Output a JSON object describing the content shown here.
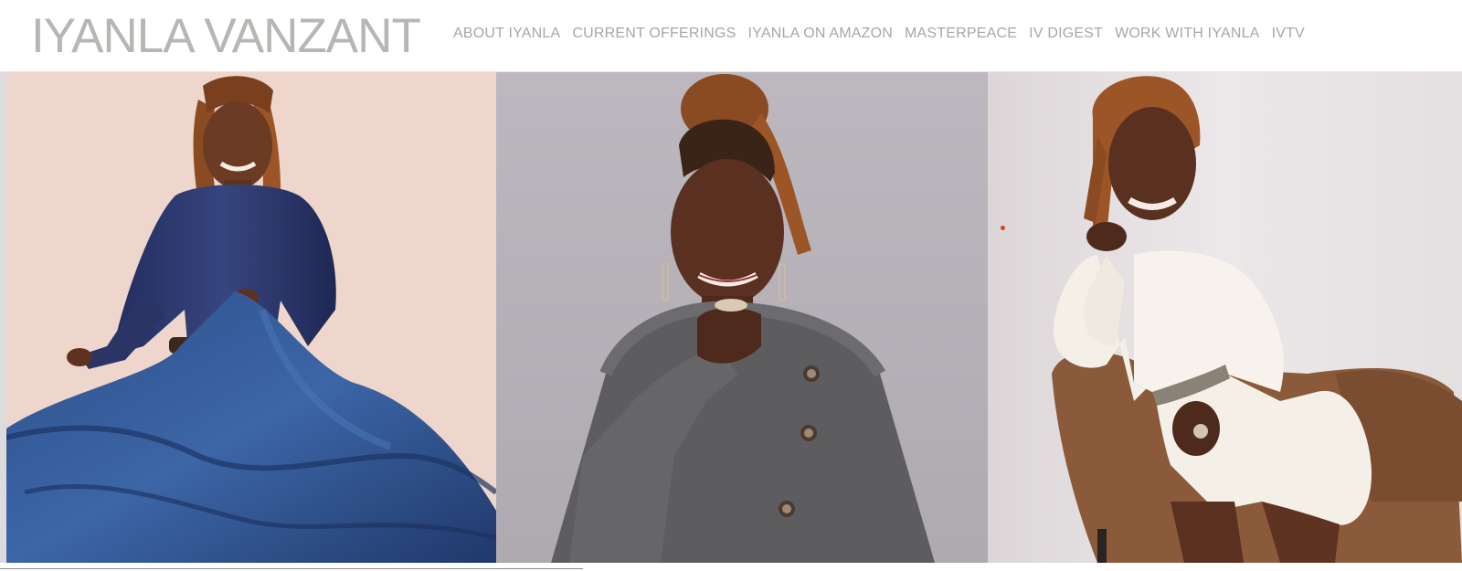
{
  "header": {
    "logo_text": "IYANLA VANZANT",
    "nav": [
      {
        "label": "ABOUT IYANLA"
      },
      {
        "label": "CURRENT OFFERINGS"
      },
      {
        "label": "IYANLA ON AMAZON"
      },
      {
        "label": "MASTERPEACE"
      },
      {
        "label": "IV DIGEST"
      },
      {
        "label": "WORK WITH IYANLA"
      },
      {
        "label": "IVTV"
      }
    ]
  },
  "gallery": {
    "photos": [
      {
        "subject": "woman-in-navy-satin-blouse-and-blue-ruffled-skirt"
      },
      {
        "subject": "woman-in-grey-wool-coat-hand-on-chin"
      },
      {
        "subject": "woman-in-white-dress-seated-on-brown-chair"
      }
    ]
  },
  "colors": {
    "logo": "#b8b6b2",
    "nav_text": "#a9a7a3",
    "panel_1_bg": "#efd6cc",
    "panel_2_bg": "#b8b4ba",
    "panel_3_bg": "#e8e2e3"
  }
}
